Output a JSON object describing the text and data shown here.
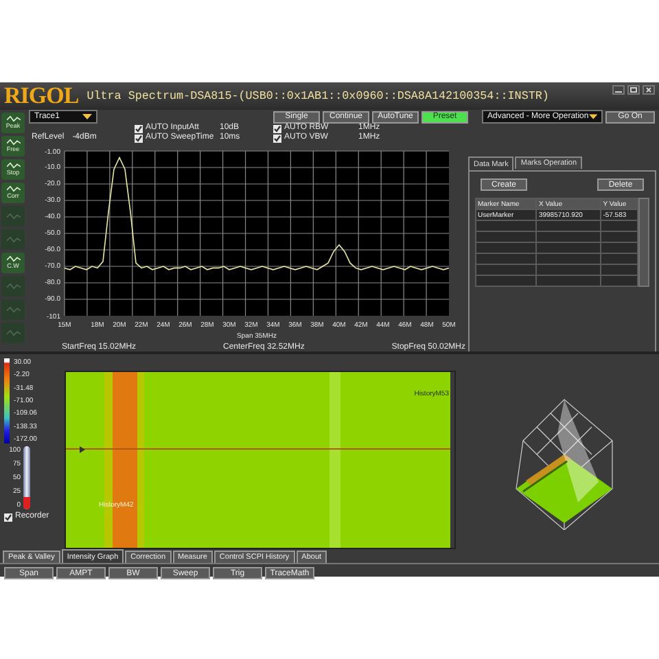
{
  "window": {
    "logo": "RIGOL",
    "title": "Ultra Spectrum-DSA815-(USB0::0x1AB1::0x0960::DSA8A142100354::INSTR)"
  },
  "sidebar": [
    {
      "label": "Peak",
      "disabled": false
    },
    {
      "label": "Free",
      "disabled": false
    },
    {
      "label": "Stop",
      "disabled": false
    },
    {
      "label": "Corr",
      "disabled": false
    },
    {
      "disabled": true
    },
    {
      "disabled": true
    },
    {
      "label": "C.W",
      "disabled": false
    },
    {
      "disabled": true
    },
    {
      "disabled": true
    },
    {
      "disabled": true
    }
  ],
  "trace_select": {
    "value": "Trace1"
  },
  "toolbar": [
    {
      "label": "Single",
      "selected": false
    },
    {
      "label": "Continue",
      "selected": false
    },
    {
      "label": "AutoTune",
      "selected": false
    },
    {
      "label": "Preset",
      "selected": true
    }
  ],
  "operation_select": {
    "value": "Advanced - More Operation"
  },
  "go_button": "Go On",
  "ref_level": {
    "label": "RefLevel",
    "value": "-4dBm"
  },
  "settings": [
    {
      "label": "AUTO InputAtt",
      "value": "10dB",
      "checked": true
    },
    {
      "label": "AUTO SweepTime",
      "value": "10ms",
      "checked": true
    },
    {
      "label": "AUTO RBW",
      "value": "1MHz",
      "checked": true
    },
    {
      "label": "AUTO VBW",
      "value": "1MHz",
      "checked": true
    }
  ],
  "spectrum": {
    "chart_data": {
      "type": "line",
      "grid": true,
      "xlim": [
        15,
        50
      ],
      "ylim": [
        -101,
        -1
      ],
      "xticks": [
        {
          "value": 15,
          "label": "15M"
        },
        {
          "value": 18,
          "label": "18M"
        },
        {
          "value": 20,
          "label": "20M"
        },
        {
          "value": 22,
          "label": "22M"
        },
        {
          "value": 24,
          "label": "24M"
        },
        {
          "value": 26,
          "label": "26M"
        },
        {
          "value": 28,
          "label": "28M"
        },
        {
          "value": 30,
          "label": "30M"
        },
        {
          "value": 32,
          "label": "32M"
        },
        {
          "value": 34,
          "label": "34M"
        },
        {
          "value": 36,
          "label": "36M"
        },
        {
          "value": 38,
          "label": "38M"
        },
        {
          "value": 40,
          "label": "40M"
        },
        {
          "value": 42,
          "label": "42M"
        },
        {
          "value": 44,
          "label": "44M"
        },
        {
          "value": 46,
          "label": "46M"
        },
        {
          "value": 48,
          "label": "48M"
        },
        {
          "value": 50,
          "label": "50M"
        }
      ],
      "yticks": [
        {
          "value": -1,
          "label": "-1.00"
        },
        {
          "value": -10,
          "label": "-10.0"
        },
        {
          "value": -20,
          "label": "-20.0"
        },
        {
          "value": -30,
          "label": "-30.0"
        },
        {
          "value": -40,
          "label": "-40.0"
        },
        {
          "value": -50,
          "label": "-50.0"
        },
        {
          "value": -60,
          "label": "-60.0"
        },
        {
          "value": -70,
          "label": "-70.0"
        },
        {
          "value": -80,
          "label": "-80.0"
        },
        {
          "value": -90,
          "label": "-90.0"
        },
        {
          "value": -101,
          "label": "-101"
        }
      ],
      "x": [
        15,
        15.5,
        16,
        16.5,
        17,
        17.5,
        18,
        18.5,
        19,
        19.5,
        20,
        20.5,
        21,
        21.5,
        22,
        22.5,
        23,
        23.5,
        24,
        24.5,
        25,
        25.5,
        26,
        26.5,
        27,
        27.5,
        28,
        28.5,
        29,
        29.5,
        30,
        30.5,
        31,
        31.5,
        32,
        32.5,
        33,
        33.5,
        34,
        34.5,
        35,
        35.5,
        36,
        36.5,
        37,
        37.5,
        38,
        38.5,
        39,
        39.5,
        40,
        40.5,
        41,
        41.5,
        42,
        42.5,
        43,
        43.5,
        44,
        44.5,
        45,
        45.5,
        46,
        46.5,
        47,
        47.5,
        48,
        48.5,
        49,
        49.5,
        50
      ],
      "series": [
        {
          "color": "#e8e8a0",
          "values": [
            -72,
            -73,
            -71,
            -72,
            -73,
            -71,
            -72,
            -68,
            -38,
            -12,
            -5,
            -12,
            -38,
            -69,
            -72,
            -71,
            -73,
            -72,
            -71,
            -73,
            -72,
            -72,
            -71,
            -73,
            -72,
            -71,
            -73,
            -72,
            -72,
            -71,
            -73,
            -72,
            -71,
            -72,
            -73,
            -72,
            -71,
            -72,
            -73,
            -72,
            -71,
            -72,
            -73,
            -72,
            -71,
            -72,
            -73,
            -71,
            -69,
            -62,
            -58,
            -62,
            -69,
            -72,
            -73,
            -72,
            -71,
            -72,
            -73,
            -72,
            -71,
            -72,
            -73,
            -71,
            -72,
            -73,
            -72,
            -71,
            -72,
            -73,
            -72
          ]
        }
      ]
    },
    "span": {
      "label": "Span",
      "value": "35MHz"
    },
    "start": {
      "label": "StartFreq",
      "value": "15.02MHz"
    },
    "center": {
      "label": "CenterFreq",
      "value": "32.52MHz"
    },
    "stop": {
      "label": "StopFreq",
      "value": "50.02MHz"
    }
  },
  "marker_panel": {
    "tabs": [
      {
        "label": "Data Mark",
        "selected": true
      },
      {
        "label": "Marks Operation",
        "selected": false
      }
    ],
    "buttons": [
      "Create",
      "Delete"
    ],
    "columns": [
      "Marker Name",
      "X Value",
      "Y Value"
    ],
    "rows": [
      [
        "UserMarker",
        "39985710.920",
        "-57.583"
      ]
    ]
  },
  "color_scale": [
    "30.00",
    "-2.20",
    "-31.48",
    "-71.00",
    "-109.06",
    "-138.33",
    "-172.00"
  ],
  "thermometer": {
    "ticks": [
      "100",
      "75",
      "50",
      "25",
      "0"
    ],
    "level": 0.2
  },
  "recorder": {
    "label": "Recorder",
    "checked": true
  },
  "history_labels": [
    "HistoryM53",
    "HistoryM42"
  ],
  "bottom_tabs": [
    {
      "label": "Peak & Valley",
      "selected": false
    },
    {
      "label": "Intensity Graph",
      "selected": true
    },
    {
      "label": "Correction",
      "selected": false
    },
    {
      "label": "Measure",
      "selected": false
    },
    {
      "label": "Control SCPI History",
      "selected": false
    },
    {
      "label": "About",
      "selected": false
    }
  ],
  "bottom_buttons": [
    "Span",
    "AMPT",
    "BW",
    "Sweep",
    "Trig",
    "TraceMath"
  ]
}
